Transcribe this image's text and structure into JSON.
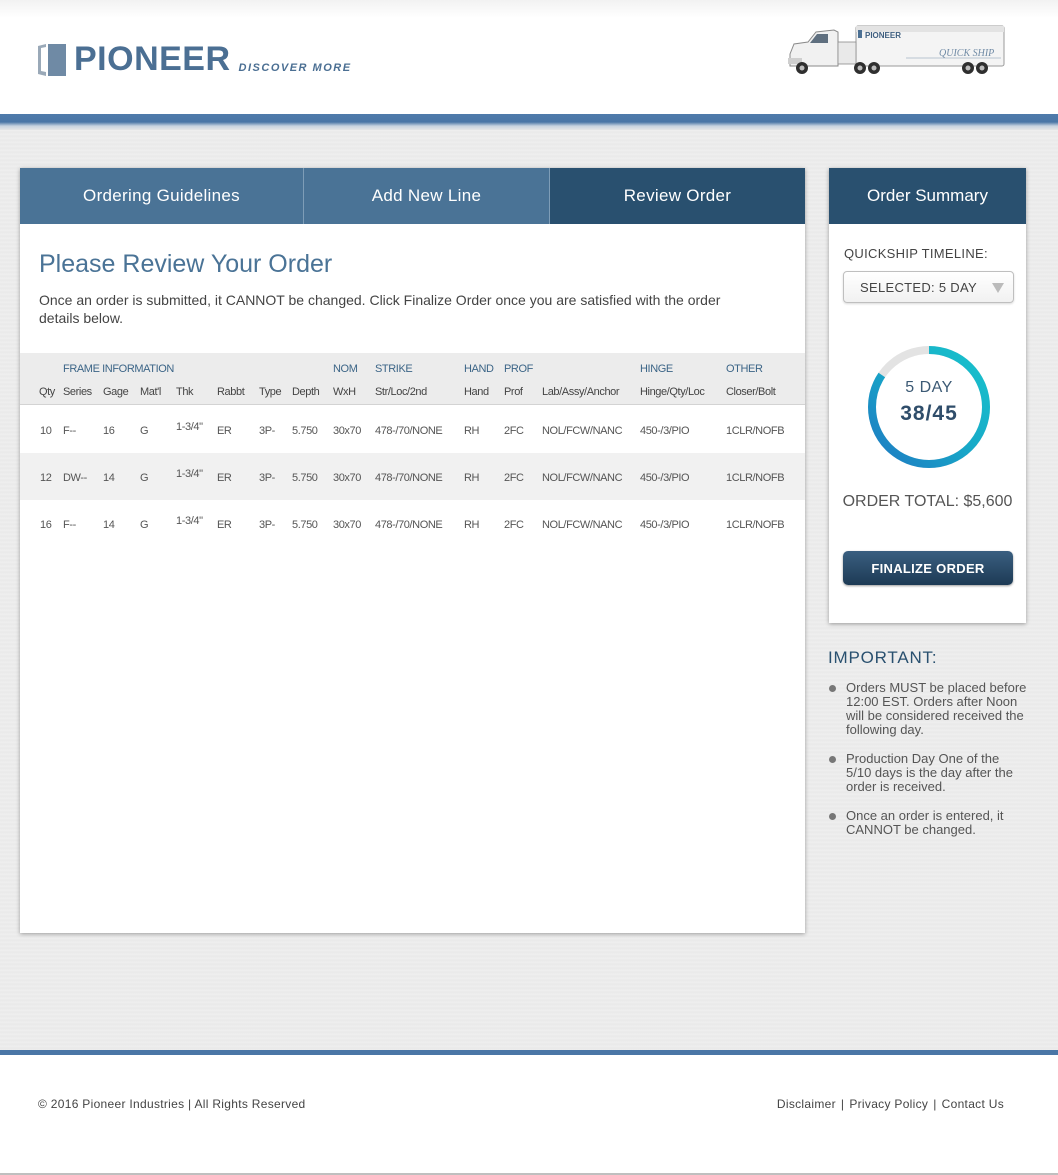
{
  "brand": {
    "name": "PIONEER",
    "tagline": "DISCOVER MORE",
    "truck_brand": "PIONEER",
    "truck_text": "QUICK SHIP"
  },
  "tabs": [
    {
      "label": "Ordering Guidelines",
      "active": false
    },
    {
      "label": "Add New Line",
      "active": false
    },
    {
      "label": "Review Order",
      "active": true
    }
  ],
  "main": {
    "title": "Please Review Your Order",
    "notice": "Once an order is submitted, it CANNOT be changed. Click Finalize Order once you are satisfied with the order details below."
  },
  "table": {
    "groups": {
      "frame": "FRAME INFORMATION",
      "nom": "NOM",
      "strike": "STRIKE",
      "hand": "HAND",
      "prof": "PROF",
      "hinge": "HINGE",
      "other": "OTHER"
    },
    "columns": [
      "Qty",
      "Series",
      "Gage",
      "Mat'l",
      "Thk",
      "Rabbt",
      "Type",
      "Depth",
      "WxH",
      "Str/Loc/2nd",
      "Hand",
      "Prof",
      "Lab/Assy/Anchor",
      "Hinge/Qty/Loc",
      "Closer/Bolt"
    ],
    "rows": [
      [
        "10",
        "F--",
        "16",
        "G",
        "1-3/4\"",
        "ER",
        "3P-",
        "5.750",
        "30x70",
        "478-/70/NONE",
        "RH",
        "2FC",
        "NOL/FCW/NANC",
        "450-/3/PIO",
        "1CLR/NOFB"
      ],
      [
        "12",
        "DW--",
        "14",
        "G",
        "1-3/4\"",
        "ER",
        "3P-",
        "5.750",
        "30x70",
        "478-/70/NONE",
        "RH",
        "2FC",
        "NOL/FCW/NANC",
        "450-/3/PIO",
        "1CLR/NOFB"
      ],
      [
        "16",
        "F--",
        "14",
        "G",
        "1-3/4\"",
        "ER",
        "3P-",
        "5.750",
        "30x70",
        "478-/70/NONE",
        "RH",
        "2FC",
        "NOL/FCW/NANC",
        "450-/3/PIO",
        "1CLR/NOFB"
      ]
    ]
  },
  "summary": {
    "title": "Order Summary",
    "timeline_label": "QUICKSHIP TIMELINE:",
    "timeline_selected": "SELECTED: 5 DAY",
    "ring_label": "5 DAY",
    "ring_count": "38/45",
    "ring_progress": 0.844,
    "order_total": "ORDER TOTAL: $5,600",
    "finalize_label": "FINALIZE ORDER"
  },
  "important": {
    "title": "IMPORTANT:",
    "items": [
      "Orders MUST be placed before 12:00 EST. Orders after Noon will be considered received the following day.",
      "Production Day One of the 5/10 days is the day after the order is received.",
      "Once an order is entered, it CANNOT be changed."
    ]
  },
  "footer": {
    "copyright": "© 2016 Pioneer Industries | All Rights Reserved",
    "links": [
      "Disclaimer",
      "Privacy Policy",
      "Contact Us"
    ]
  },
  "colors": {
    "brand_blue": "#4a7396",
    "dark_blue": "#29506f",
    "ring_teal": "#17b5c8",
    "ring_blue": "#1e78c2"
  }
}
